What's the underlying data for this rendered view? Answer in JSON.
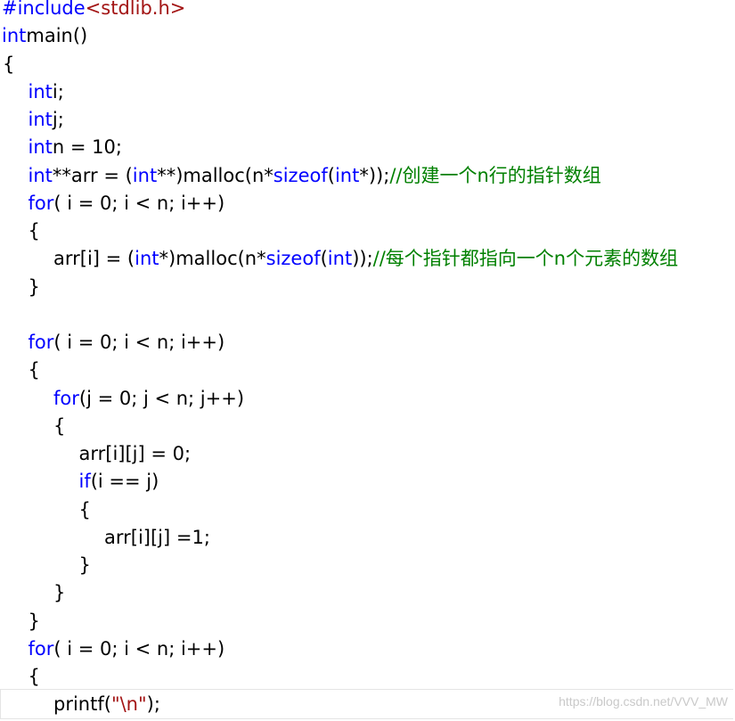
{
  "editor": {
    "lines": [
      {
        "tokens": [
          {
            "t": "#include",
            "k": "pp"
          },
          {
            "t": "<stdlib.h>",
            "k": "inc"
          }
        ]
      },
      {
        "tokens": [
          {
            "t": "int",
            "k": "kw"
          },
          {
            "t": " main()",
            "k": "plain"
          }
        ]
      },
      {
        "tokens": [
          {
            "t": "{",
            "k": "plain"
          }
        ]
      },
      {
        "tokens": [
          {
            "t": "    ",
            "k": "plain"
          },
          {
            "t": "int",
            "k": "kw"
          },
          {
            "t": " i;",
            "k": "plain"
          }
        ]
      },
      {
        "tokens": [
          {
            "t": "    ",
            "k": "plain"
          },
          {
            "t": "int",
            "k": "kw"
          },
          {
            "t": " j;",
            "k": "plain"
          }
        ]
      },
      {
        "tokens": [
          {
            "t": "    ",
            "k": "plain"
          },
          {
            "t": "int",
            "k": "kw"
          },
          {
            "t": " n = 10;",
            "k": "plain"
          }
        ]
      },
      {
        "tokens": [
          {
            "t": "    ",
            "k": "plain"
          },
          {
            "t": "int",
            "k": "kw"
          },
          {
            "t": " **arr = (",
            "k": "plain"
          },
          {
            "t": "int",
            "k": "kw"
          },
          {
            "t": " **)malloc(n*",
            "k": "plain"
          },
          {
            "t": "sizeof",
            "k": "kw"
          },
          {
            "t": "(",
            "k": "plain"
          },
          {
            "t": "int",
            "k": "kw"
          },
          {
            "t": "*));",
            "k": "plain"
          },
          {
            "t": "//创建一个n行的指针数组",
            "k": "cm"
          }
        ]
      },
      {
        "tokens": [
          {
            "t": "    ",
            "k": "plain"
          },
          {
            "t": "for",
            "k": "kw"
          },
          {
            "t": "( i = 0; i < n; i++)",
            "k": "plain"
          }
        ]
      },
      {
        "tokens": [
          {
            "t": "    {",
            "k": "plain"
          }
        ]
      },
      {
        "tokens": [
          {
            "t": "        arr[i] = (",
            "k": "plain"
          },
          {
            "t": "int",
            "k": "kw"
          },
          {
            "t": " *)malloc(n*",
            "k": "plain"
          },
          {
            "t": "sizeof",
            "k": "kw"
          },
          {
            "t": "(",
            "k": "plain"
          },
          {
            "t": "int",
            "k": "kw"
          },
          {
            "t": "));",
            "k": "plain"
          },
          {
            "t": "//每个指针都指向一个n个元素的数组",
            "k": "cm"
          }
        ]
      },
      {
        "tokens": [
          {
            "t": "    }",
            "k": "plain"
          }
        ]
      },
      {
        "tokens": []
      },
      {
        "tokens": [
          {
            "t": "    ",
            "k": "plain"
          },
          {
            "t": "for",
            "k": "kw"
          },
          {
            "t": "( i = 0; i < n; i++)",
            "k": "plain"
          }
        ]
      },
      {
        "tokens": [
          {
            "t": "    {",
            "k": "plain"
          }
        ]
      },
      {
        "tokens": [
          {
            "t": "        ",
            "k": "plain"
          },
          {
            "t": "for",
            "k": "kw"
          },
          {
            "t": "(j = 0; j < n; j++)",
            "k": "plain"
          }
        ]
      },
      {
        "tokens": [
          {
            "t": "        {",
            "k": "plain"
          }
        ]
      },
      {
        "tokens": [
          {
            "t": "            arr[i][j] = 0;",
            "k": "plain"
          }
        ]
      },
      {
        "tokens": [
          {
            "t": "            ",
            "k": "plain"
          },
          {
            "t": "if",
            "k": "kw"
          },
          {
            "t": "(i == j)",
            "k": "plain"
          }
        ]
      },
      {
        "tokens": [
          {
            "t": "            {",
            "k": "plain"
          }
        ]
      },
      {
        "tokens": [
          {
            "t": "                arr[i][j] =1;",
            "k": "plain"
          }
        ]
      },
      {
        "tokens": [
          {
            "t": "            }",
            "k": "plain"
          }
        ]
      },
      {
        "tokens": [
          {
            "t": "        }",
            "k": "plain"
          }
        ]
      },
      {
        "tokens": [
          {
            "t": "    }",
            "k": "plain"
          }
        ]
      },
      {
        "tokens": [
          {
            "t": "    ",
            "k": "plain"
          },
          {
            "t": "for",
            "k": "kw"
          },
          {
            "t": "( i = 0; i < n; i++)",
            "k": "plain"
          }
        ]
      },
      {
        "tokens": [
          {
            "t": "    {",
            "k": "plain"
          }
        ]
      },
      {
        "tokens": [
          {
            "t": "        printf(",
            "k": "plain"
          },
          {
            "t": "\"\\n\"",
            "k": "str"
          },
          {
            "t": ");",
            "k": "plain"
          }
        ]
      }
    ]
  },
  "watermark": {
    "text": "https://blog.csdn.net/VVV_MW"
  },
  "colors": {
    "keyword": "#0000ff",
    "include_path": "#a31515",
    "string": "#a31515",
    "comment": "#008000",
    "text": "#000000",
    "background": "#ffffff"
  }
}
